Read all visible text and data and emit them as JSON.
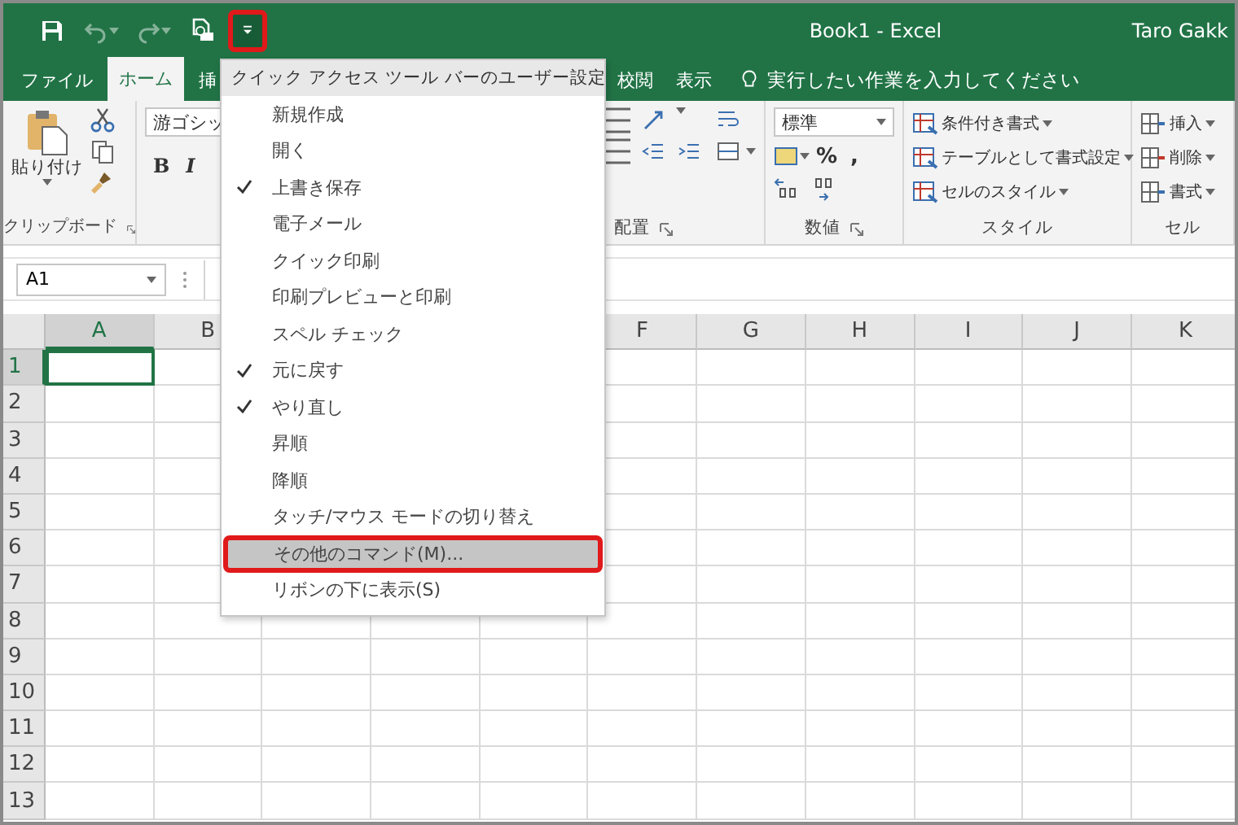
{
  "window": {
    "title": "Book1 - Excel",
    "user": "Taro Gakk"
  },
  "quick_access": [
    {
      "kind": "save",
      "disabled": false
    },
    {
      "kind": "undo",
      "disabled": true
    },
    {
      "kind": "redo",
      "disabled": true
    },
    {
      "kind": "print-preview",
      "disabled": false
    },
    {
      "kind": "customize",
      "disabled": false,
      "annotated": true
    }
  ],
  "tabs": [
    {
      "label": "ファイル",
      "selected": false
    },
    {
      "label": "ホーム",
      "selected": true
    },
    {
      "label": "挿",
      "selected": false
    },
    {
      "label": "校閲",
      "selected": false
    },
    {
      "label": "表示",
      "selected": false
    }
  ],
  "tell_me": "実行したい作業を入力してください",
  "ribbon": {
    "clipboard": {
      "paste": "貼り付け",
      "label": "クリップボード"
    },
    "font": {
      "font_name": "游ゴシッ",
      "bold": "B",
      "italic": "I"
    },
    "alignment": {
      "label": "配置"
    },
    "number": {
      "format": "標準",
      "percent": "%",
      "comma": ",",
      "label": "数値"
    },
    "styles": {
      "items": [
        "条件付き書式",
        "テーブルとして書式設定",
        "セルのスタイル"
      ],
      "label": "スタイル"
    },
    "cells": {
      "items": [
        "挿入",
        "削除",
        "書式"
      ],
      "label": "セル"
    }
  },
  "name_box": "A1",
  "menu": {
    "title": "クイック アクセス ツール バーのユーザー設定",
    "items": [
      {
        "label": "新規作成",
        "kind": "toggle",
        "checked": false,
        "selected": false
      },
      {
        "label": "開く",
        "kind": "toggle",
        "checked": false,
        "selected": false
      },
      {
        "label": "上書き保存",
        "kind": "toggle",
        "checked": true,
        "selected": false
      },
      {
        "label": "電子メール",
        "kind": "toggle",
        "checked": false,
        "selected": false
      },
      {
        "label": "クイック印刷",
        "kind": "toggle",
        "checked": false,
        "selected": false
      },
      {
        "label": "印刷プレビューと印刷",
        "kind": "toggle",
        "checked": false,
        "selected": false
      },
      {
        "label": "スペル チェック",
        "kind": "toggle",
        "checked": false,
        "selected": false
      },
      {
        "label": "元に戻す",
        "kind": "toggle",
        "checked": true,
        "selected": false
      },
      {
        "label": "やり直し",
        "kind": "toggle",
        "checked": true,
        "selected": false
      },
      {
        "label": "昇順",
        "kind": "toggle",
        "checked": false,
        "selected": false
      },
      {
        "label": "降順",
        "kind": "toggle",
        "checked": false,
        "selected": false
      },
      {
        "label": "タッチ/マウス モードの切り替え",
        "kind": "toggle",
        "checked": false,
        "selected": false
      },
      {
        "label": "その他のコマンド(M)...",
        "kind": "command",
        "selected": true,
        "annotated": true
      },
      {
        "label": "リボンの下に表示(S)",
        "kind": "command",
        "selected": false,
        "annotated": false
      }
    ]
  },
  "columns": [
    {
      "label": "A",
      "selected": true
    },
    {
      "label": "B",
      "selected": false
    },
    {
      "label": "F",
      "selected": false
    },
    {
      "label": "G",
      "selected": false
    },
    {
      "label": "H",
      "selected": false
    },
    {
      "label": "I",
      "selected": false
    },
    {
      "label": "J",
      "selected": false
    },
    {
      "label": "K",
      "selected": false
    }
  ],
  "rows": [
    {
      "label": "1",
      "selected": true
    },
    {
      "label": "2",
      "selected": false
    },
    {
      "label": "3",
      "selected": false
    },
    {
      "label": "4",
      "selected": false
    },
    {
      "label": "5",
      "selected": false
    },
    {
      "label": "6",
      "selected": false
    },
    {
      "label": "7",
      "selected": false
    },
    {
      "label": "8",
      "selected": false
    },
    {
      "label": "9",
      "selected": false
    },
    {
      "label": "10",
      "selected": false
    },
    {
      "label": "11",
      "selected": false
    },
    {
      "label": "12",
      "selected": false
    },
    {
      "label": "13",
      "selected": false
    }
  ]
}
